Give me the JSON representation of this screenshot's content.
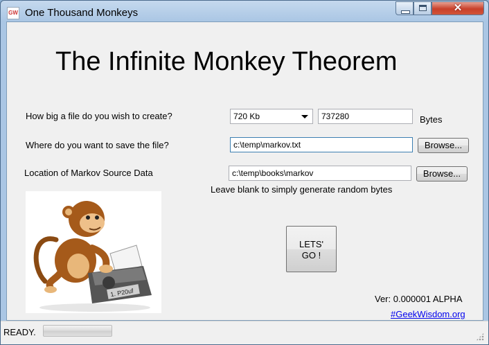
{
  "window": {
    "title": "One Thousand Monkeys",
    "app_icon_text": "GW"
  },
  "heading": "The Infinite Monkey Theorem",
  "form": {
    "size_question": "How big a file do you wish to create?",
    "size_option": "720 Kb",
    "size_bytes_value": "737280",
    "bytes_label": "Bytes",
    "save_question": "Where do you want to save the file?",
    "save_path": "c:\\temp\\markov.txt",
    "browse_label": "Browse...",
    "source_label": "Location of Markov Source Data",
    "source_path": "c:\\temp\\books\\markov",
    "source_hint": "Leave blank to simply generate random bytes"
  },
  "go_button": {
    "line1": "LETS'",
    "line2": "GO !"
  },
  "version": "Ver: 0.000001 ALPHA",
  "link": "#GeekWisdom.org",
  "status": {
    "text": "READY.",
    "progress": 0
  },
  "image": {
    "typewriter_paper_text": "1. P20uf"
  }
}
